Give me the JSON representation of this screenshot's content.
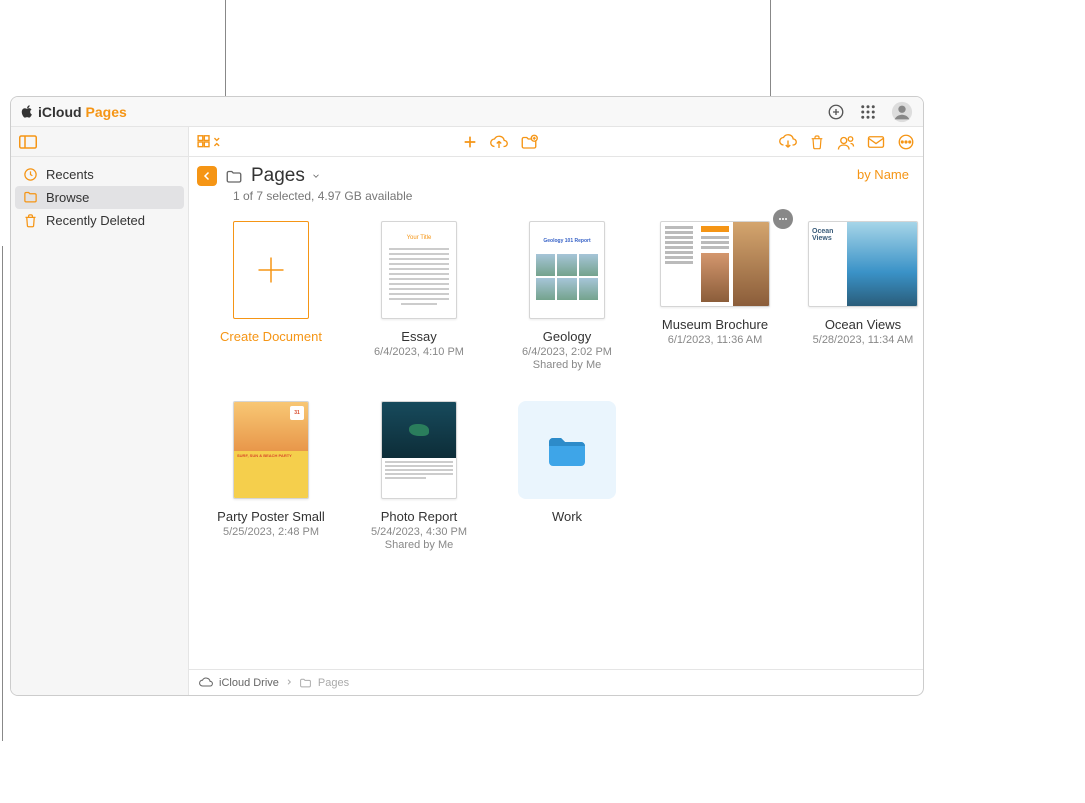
{
  "brand": {
    "icloud": "iCloud",
    "pages": "Pages"
  },
  "sidebar": {
    "items": [
      {
        "label": "Recents"
      },
      {
        "label": "Browse"
      },
      {
        "label": "Recently Deleted"
      }
    ]
  },
  "header": {
    "folder_title": "Pages",
    "status": "1 of 7 selected, 4.97 GB available",
    "sort_label": "by Name"
  },
  "tiles": {
    "create": {
      "label": "Create Document"
    },
    "essay": {
      "label": "Essay",
      "meta": "6/4/2023, 4:10 PM"
    },
    "geology": {
      "label": "Geology",
      "meta": "6/4/2023, 2:02 PM",
      "shared": "Shared by Me"
    },
    "museum": {
      "label": "Museum Brochure",
      "meta": "6/1/2023, 11:36 AM"
    },
    "ocean": {
      "label": "Ocean Views",
      "meta": "5/28/2023, 11:34 AM"
    },
    "party": {
      "label": "Party Poster Small",
      "meta": "5/25/2023, 2:48 PM"
    },
    "photo": {
      "label": "Photo Report",
      "meta": "5/24/2023, 4:30 PM",
      "shared": "Shared by Me"
    },
    "work": {
      "label": "Work"
    }
  },
  "breadcrumb": {
    "root": "iCloud Drive",
    "current": "Pages"
  },
  "thumbs": {
    "essay_title": "Your Title",
    "geology_title": "Geology 101 Report",
    "ocean_title": "Ocean Views",
    "party_date": "31",
    "party_text": "SURF, SUN & BEACH PARTY"
  }
}
